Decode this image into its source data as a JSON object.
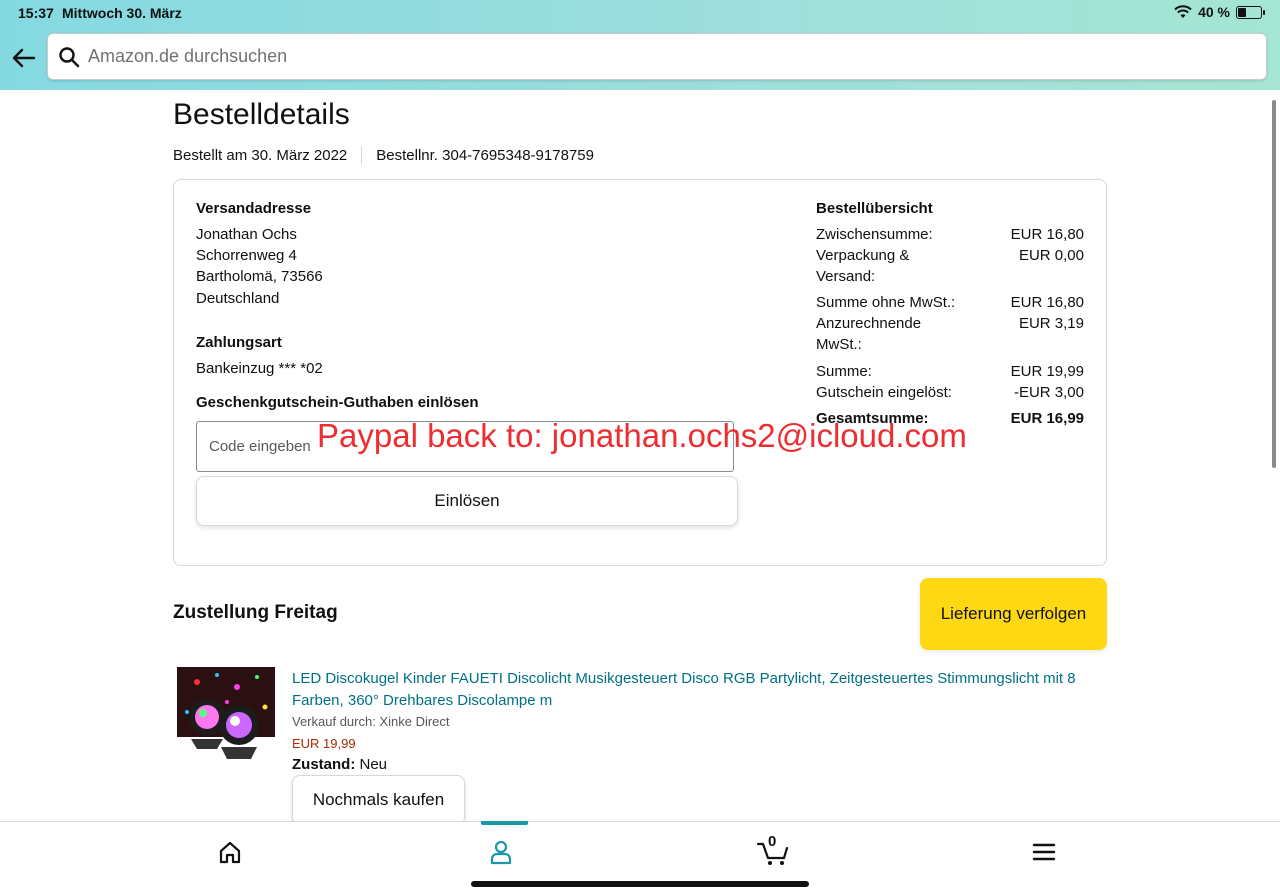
{
  "status_bar": {
    "time": "15:37",
    "date": "Mittwoch 30. März",
    "battery": "40 %",
    "battery_level": 0.4
  },
  "search": {
    "placeholder": "Amazon.de durchsuchen"
  },
  "page": {
    "title": "Bestelldetails",
    "order_date": "Bestellt am 30. März 2022",
    "order_number": "Bestellnr. 304-7695348-9178759"
  },
  "shipping": {
    "heading": "Versandadresse",
    "lines": [
      "Jonathan Ochs",
      "Schorrenweg 4",
      "Bartholomä, 73566",
      "Deutschland"
    ]
  },
  "payment": {
    "heading": "Zahlungsart",
    "method": "Bankeinzug *** *02"
  },
  "gift_card": {
    "heading": "Geschenkgutschein-Guthaben einlösen",
    "input_placeholder": "Code eingeben",
    "redeem_label": "Einlösen"
  },
  "overlay_note": "Paypal back to: jonathan.ochs2@icloud.com",
  "summary": {
    "heading": "Bestellübersicht",
    "rows": [
      {
        "label": "Zwischensumme:",
        "value": "EUR 16,80"
      },
      {
        "label": "Verpackung & Versand:",
        "value": "EUR 0,00"
      },
      {
        "label": "Summe ohne MwSt.:",
        "value": "EUR 16,80"
      },
      {
        "label": "Anzurechnende MwSt.:",
        "value": "EUR 3,19"
      },
      {
        "label": "Summe:",
        "value": "EUR 19,99"
      },
      {
        "label": "Gutschein eingelöst:",
        "value": "-EUR 3,00"
      },
      {
        "label": "Gesamtsumme:",
        "value": "EUR 16,99"
      }
    ]
  },
  "delivery": {
    "heading": "Zustellung Freitag",
    "track_label": "Lieferung verfolgen",
    "item": {
      "title": "LED Discokugel Kinder FAUETI Discolicht Musikgesteuert Disco RGB Partylicht, Zeitgesteuertes Stimmungslicht mit 8 Farben, 360° Drehbares Discolampe m",
      "seller": "Verkauf durch: Xinke Direct",
      "price": "EUR 19,99",
      "condition_label": "Zustand:",
      "condition_value": "Neu",
      "rebuy_label": "Nochmals kaufen"
    }
  },
  "bottom_nav": {
    "cart_count": "0"
  },
  "colors": {
    "accent": "#1a98a8",
    "link": "#007185",
    "price": "#b12704",
    "button_yellow": "#ffd814",
    "note_red": "#ee2d31"
  }
}
